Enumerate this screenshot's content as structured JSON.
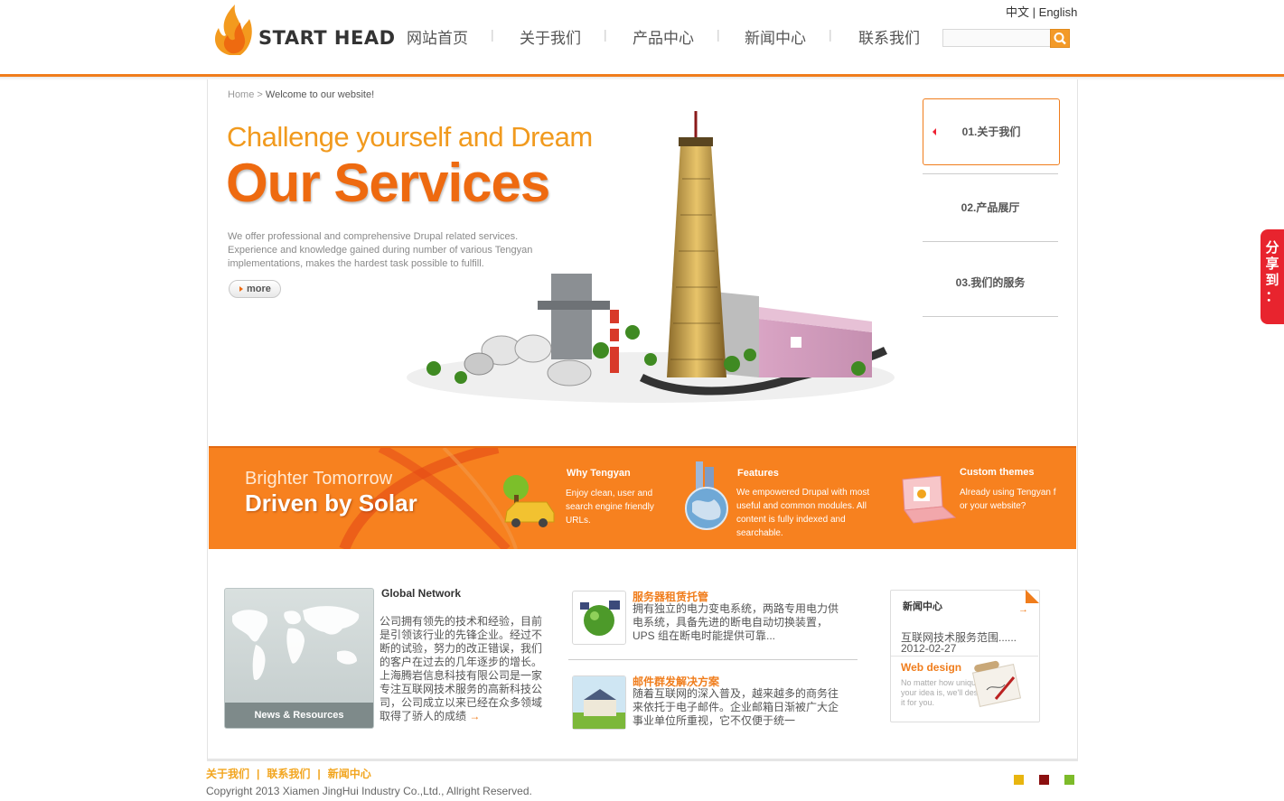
{
  "header": {
    "logo_text": "START HEAD",
    "nav": [
      "网站首页",
      "关于我们",
      "产品中心",
      "新闻中心",
      "联系我们"
    ],
    "lang_zh": "中文",
    "lang_sep": "|",
    "lang_en": "English",
    "search_placeholder": ""
  },
  "breadcrumb": {
    "home": "Home",
    "separator": ">",
    "current": "Welcome to our website!"
  },
  "hero": {
    "subtitle": "Challenge yourself and Dream",
    "title": "Our Services",
    "description": "We offer professional and comprehensive Drupal related services. Experience and knowledge gained during number of various Tengyan implementations, makes the hardest task possible to fulfill.",
    "more_label": "more"
  },
  "side_menu": [
    {
      "label": "01.关于我们",
      "active": true
    },
    {
      "label": "02.产品展厅",
      "active": false
    },
    {
      "label": "03.我们的服务",
      "active": false
    }
  ],
  "banner": {
    "tagline1": "Brighter Tomorrow",
    "tagline2": "Driven by Solar",
    "features": [
      {
        "title": "Why Tengyan",
        "desc": "Enjoy clean, user and search engine friendly URLs."
      },
      {
        "title": "Features",
        "desc": "We empowered Drupal with most useful and common modules. All content is fully indexed and searchable."
      },
      {
        "title": "Custom themes",
        "desc": "Already using Tengyan f or your website?"
      }
    ]
  },
  "global_network": {
    "title": "Global Network",
    "image_label": "News & Resources",
    "text": "公司拥有领先的技术和经验，目前是引领该行业的先锋企业。经过不断的试验，努力的改正错误，我们的客户在过去的几年逐步的增长。上海腾岩信息科技有限公司是一家专注互联网技术服务的高新科技公司，公司成立以来已经在众多领域取得了骄人的成绩",
    "arrow": "→"
  },
  "services": [
    {
      "title": "服务器租赁托管",
      "text": "拥有独立的电力变电系统，两路专用电力供电系统，具备先进的断电自动切换装置，UPS 组在断电时能提供可靠..."
    },
    {
      "title": "邮件群发解决方案",
      "text": "随着互联网的深入普及，越来越多的商务往来依托于电子邮件。企业邮箱日渐被广大企事业单位所重视，它不仅便于统一"
    }
  ],
  "news": {
    "title": "新闻中心",
    "arrow": "→",
    "item": "互联网技术服务范围......",
    "date": "2012-02-27",
    "web_design_title": "Web design",
    "web_design_text": "No matter how unique your idea is, we'll design it for you."
  },
  "footer": {
    "links": [
      "关于我们",
      "联系我们",
      "新闻中心"
    ],
    "link_sep": "|",
    "copyright": "Copyright 2013 Xiamen JingHui Industry Co.,Ltd., Allright Reserved.",
    "swatches": [
      "#e8b50f",
      "#8b1010",
      "#7dbb2a"
    ]
  },
  "share": {
    "label": "分享到："
  },
  "colors": {
    "accent": "#f07d1c",
    "banner": "#f7811f"
  }
}
